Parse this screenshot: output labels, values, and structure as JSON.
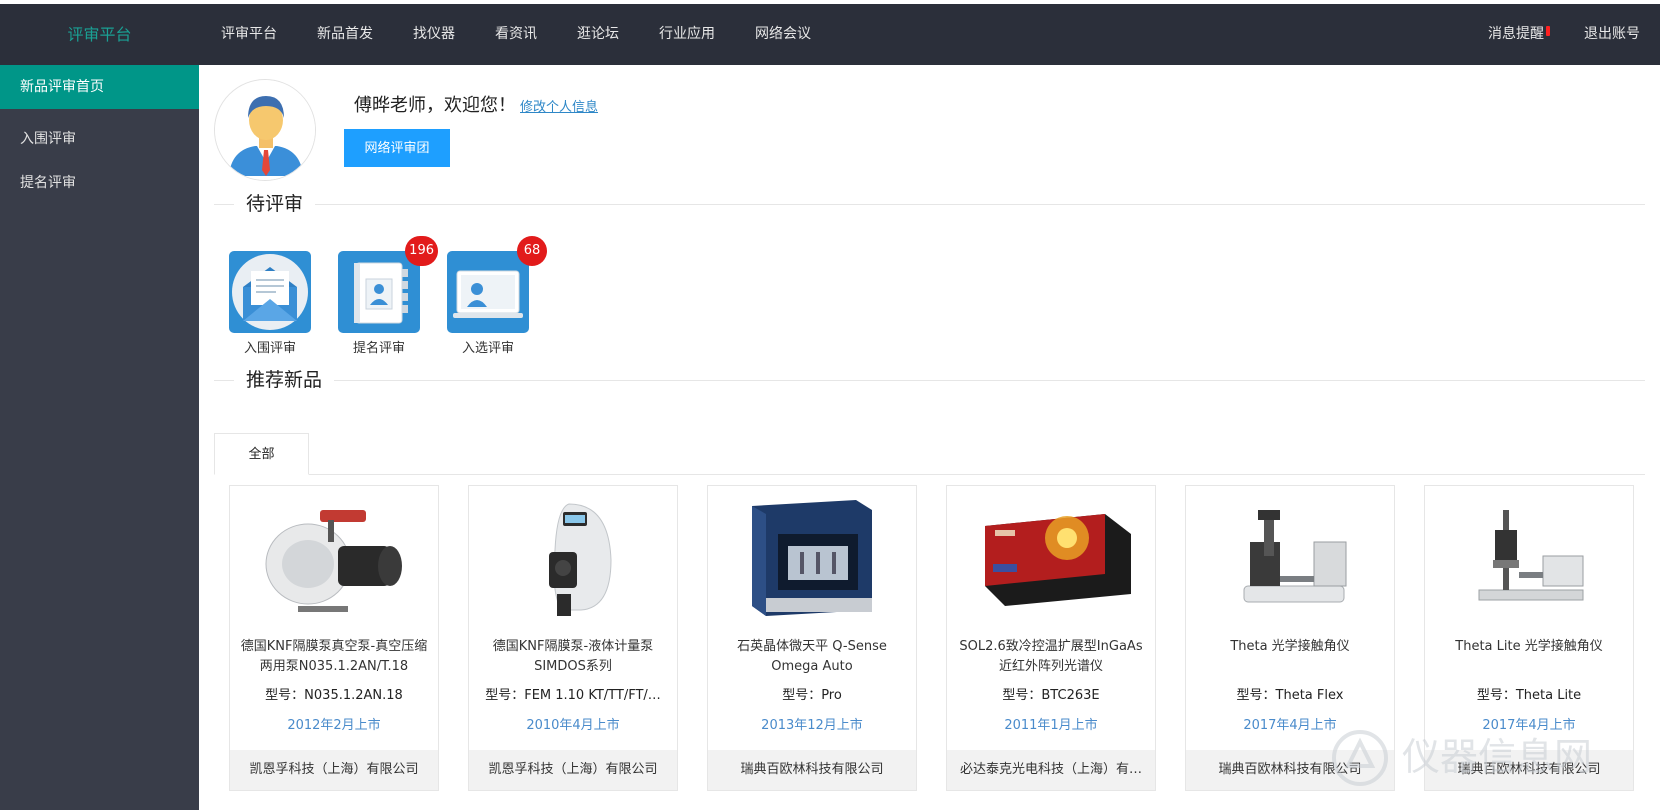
{
  "topbar": {
    "brand": "评审平台",
    "nav": [
      "评审平台",
      "新品首发",
      "找仪器",
      "看资讯",
      "逛论坛",
      "行业应用",
      "网络会议"
    ],
    "messages": "消息提醒",
    "logout": "退出账号"
  },
  "sidebar": {
    "items": [
      {
        "label": "新品评审首页",
        "active": true
      },
      {
        "label": "入围评审"
      },
      {
        "label": "提名评审"
      }
    ]
  },
  "profile": {
    "welcome": "傅晔老师，欢迎您！",
    "edit_link": "修改个人信息",
    "team_button": "网络评审团"
  },
  "pending": {
    "title": "待评审",
    "tiles": [
      {
        "label": "入围评审",
        "icon": "envelope-icon",
        "badge": null
      },
      {
        "label": "提名评审",
        "icon": "address-book-icon",
        "badge": "196"
      },
      {
        "label": "入选评审",
        "icon": "laptop-user-icon",
        "badge": "68"
      }
    ]
  },
  "recommended": {
    "title": "推荐新品",
    "tab": "全部",
    "products": [
      {
        "name": "德国KNF隔膜泵真空泵-真空压缩两用泵N035.1.2AN/T.18",
        "model": "型号：N035.1.2AN.18",
        "date": "2012年2月上市",
        "company": "凯恩孚科技（上海）有限公司",
        "image": "vacuum-pump"
      },
      {
        "name": "德国KNF隔膜泵-液体计量泵SIMDOS系列",
        "model": "型号：FEM 1.10 KT/TT/FT/…",
        "date": "2010年4月上市",
        "company": "凯恩孚科技（上海）有限公司",
        "image": "dosing-pump"
      },
      {
        "name": "石英晶体微天平 Q-Sense Omega Auto",
        "model": "型号：Pro",
        "date": "2013年12月上市",
        "company": "瑞典百欧林科技有限公司",
        "image": "microbalance"
      },
      {
        "name": "SOL2.6致冷控温扩展型InGaAs近红外阵列光谱仪",
        "model": "型号：BTC263E",
        "date": "2011年1月上市",
        "company": "必达泰克光电科技（上海）有…",
        "image": "spectrometer"
      },
      {
        "name": "Theta 光学接触角仪",
        "model": "型号：Theta Flex",
        "date": "2017年4月上市",
        "company": "瑞典百欧林科技有限公司",
        "image": "contact-angle-meter"
      },
      {
        "name": "Theta Lite 光学接触角仪",
        "model": "型号：Theta Lite",
        "date": "2017年4月上市",
        "company": "瑞典百欧林科技有限公司",
        "image": "contact-angle-meter-lite"
      }
    ]
  },
  "watermark": "仪器信息网"
}
